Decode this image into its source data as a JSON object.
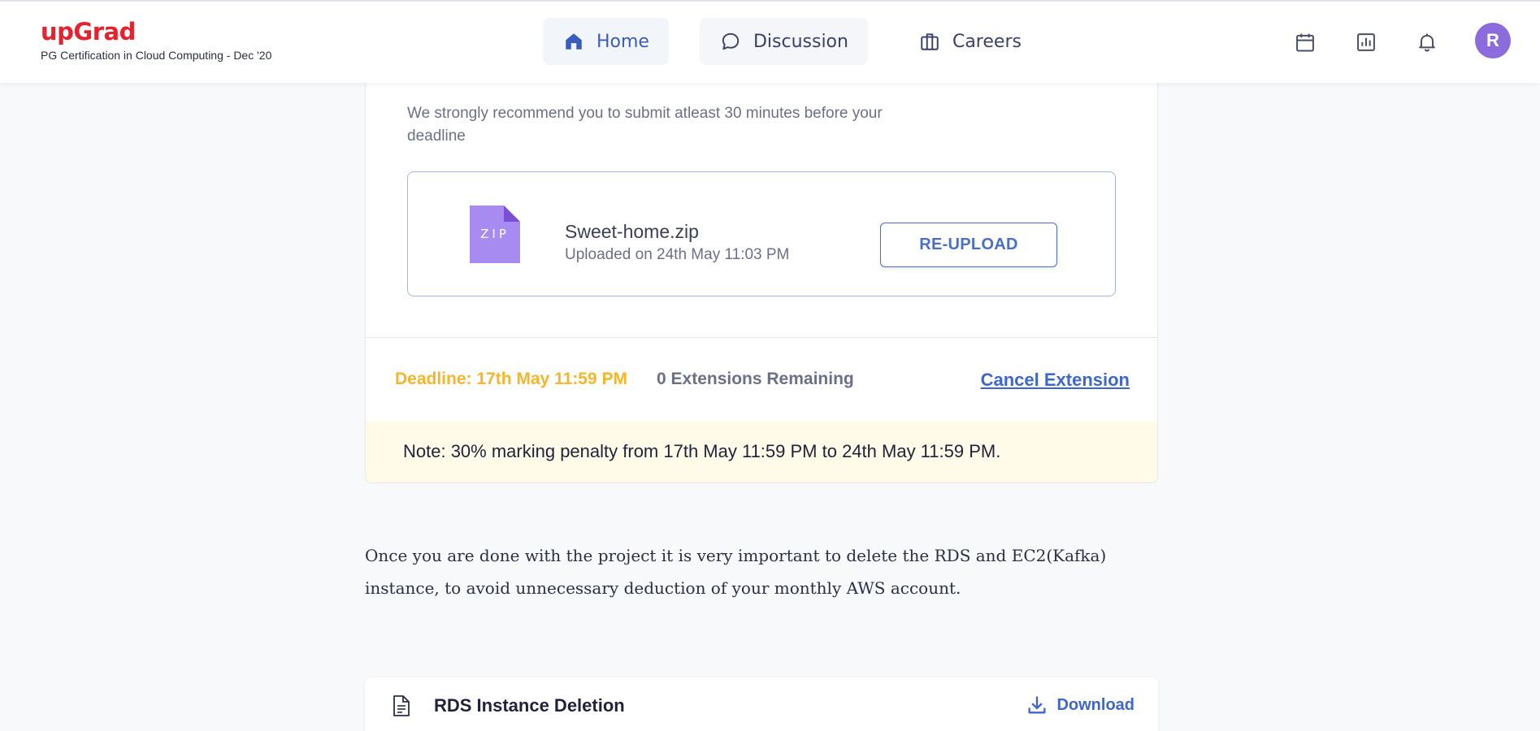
{
  "header": {
    "brand": "upGrad",
    "program": "PG Certification in Cloud Computing - Dec '20",
    "nav": [
      {
        "label": "Home",
        "icon": "home-icon"
      },
      {
        "label": "Discussion",
        "icon": "chat-bubble-icon"
      },
      {
        "label": "Careers",
        "icon": "briefcase-icon"
      }
    ],
    "right_icons": [
      "calendar-icon",
      "bar-chart-icon",
      "bell-icon"
    ],
    "avatar_initial": "R"
  },
  "submission": {
    "recommendation": "We strongly recommend you to submit atleast 30 minutes before your deadline",
    "file_type_label": "ZIP",
    "file_name": "Sweet-home.zip",
    "uploaded_on": "Uploaded on 24th May 11:03 PM",
    "reupload_label": "RE-UPLOAD",
    "deadline": "Deadline: 17th May 11:59 PM",
    "extensions_remaining": "0 Extensions Remaining",
    "cancel_extension": "Cancel Extension",
    "note": "Note: 30% marking penalty from 17th May 11:59 PM to 24th May 11:59 PM."
  },
  "paragraph": "Once you are done with the project it is very important to delete the RDS and EC2(Kafka) instance, to avoid unnecessary deduction of your monthly AWS account.",
  "resource": {
    "title": "RDS Instance Deletion",
    "download_label": "Download"
  },
  "colors": {
    "brand": "#e8212f",
    "accent": "#3d66cf",
    "deadline": "#f6b52a",
    "avatar": "#8c6cdd",
    "zip": "#a78bf0",
    "note_bg": "#fffbe8"
  }
}
